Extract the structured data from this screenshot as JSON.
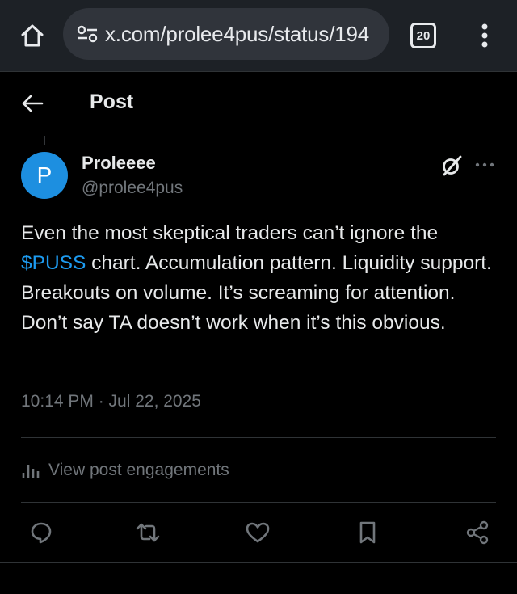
{
  "browser": {
    "url": "x.com/prolee4pus/status/194",
    "tab_count": "20",
    "icons": {
      "home": "home-icon",
      "site_info": "tune-icon",
      "menu": "kebab-menu-icon"
    }
  },
  "header": {
    "title": "Post",
    "back_icon": "arrow-left-icon"
  },
  "author": {
    "avatar_letter": "P",
    "name": "Proleeee",
    "handle": "@prolee4pus",
    "avatar_color": "#1d8fe0"
  },
  "post": {
    "text_before": "Even the most skeptical traders can’t ignore the ",
    "cashtag": "$PUSS",
    "text_after": " chart. Accumulation pattern. Liquidity support. Breakouts on volume. It’s screaming for attention. Don’t say TA doesn’t work when it’s this obvious.",
    "timestamp": "10:14 PM · Jul 22, 2025"
  },
  "engagements": {
    "label": "View post engagements",
    "icon": "bar-chart-icon"
  },
  "actions": [
    {
      "name": "reply",
      "icon": "reply-icon"
    },
    {
      "name": "repost",
      "icon": "repost-icon"
    },
    {
      "name": "like",
      "icon": "heart-icon"
    },
    {
      "name": "bookmark",
      "icon": "bookmark-icon"
    },
    {
      "name": "share",
      "icon": "share-icon"
    }
  ],
  "colors": {
    "background": "#000000",
    "browser_bar": "#1d2126",
    "accent": "#1d9bf0",
    "secondary_text": "#71767b",
    "primary_text": "#e7e9ea"
  }
}
